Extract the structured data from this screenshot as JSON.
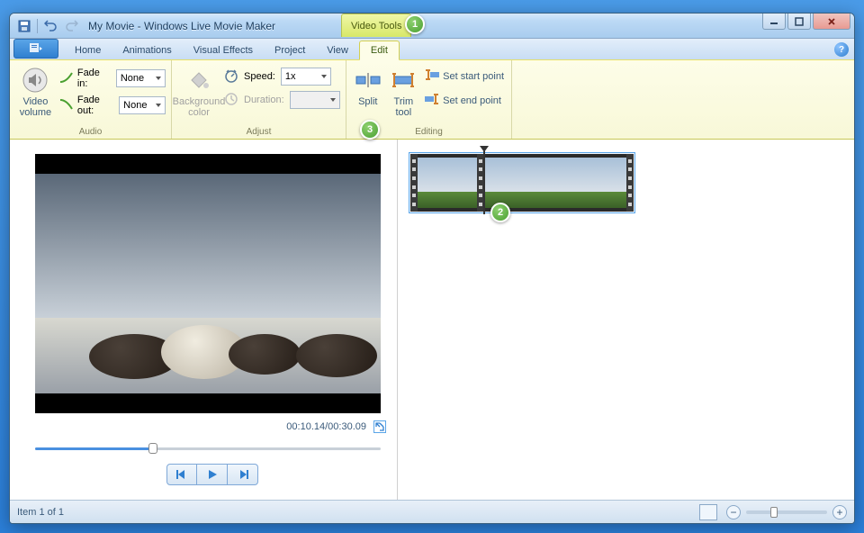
{
  "window": {
    "title": "My Movie - Windows Live Movie Maker",
    "contextual_tab": "Video Tools"
  },
  "tabs": {
    "home": "Home",
    "animations": "Animations",
    "visual_effects": "Visual Effects",
    "project": "Project",
    "view": "View",
    "edit": "Edit"
  },
  "ribbon": {
    "audio": {
      "label": "Audio",
      "video_volume": "Video\nvolume",
      "fade_in": "Fade in:",
      "fade_in_value": "None",
      "fade_out": "Fade out:",
      "fade_out_value": "None"
    },
    "adjust": {
      "label": "Adjust",
      "bg_color": "Background\ncolor",
      "speed": "Speed:",
      "speed_value": "1x",
      "duration": "Duration:",
      "duration_value": ""
    },
    "editing": {
      "label": "Editing",
      "split": "Split",
      "trim": "Trim\ntool",
      "set_start": "Set start point",
      "set_end": "Set end point"
    }
  },
  "preview": {
    "time": "00:10.14/00:30.09"
  },
  "status": {
    "item_count": "Item 1 of 1"
  },
  "callouts": {
    "c1": "1",
    "c2": "2",
    "c3": "3"
  }
}
